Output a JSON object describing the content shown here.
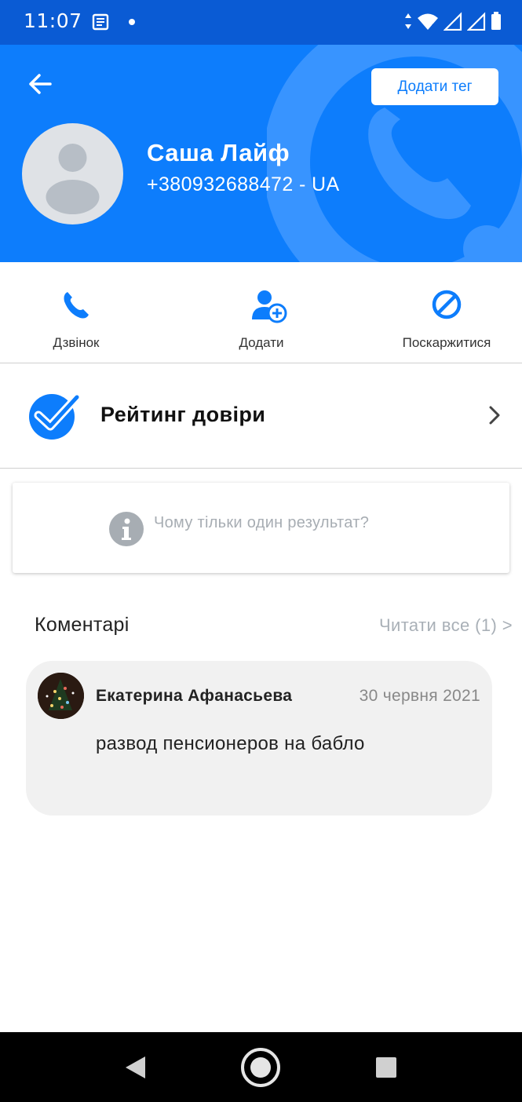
{
  "status_bar": {
    "time": "11:07",
    "icons": [
      "news-icon",
      "notification-dot",
      "data-arrows-icon",
      "wifi-icon",
      "signal-icon",
      "signal-icon-2",
      "battery-icon"
    ]
  },
  "header": {
    "add_tag_label": "Додати тег",
    "contact_name": "Саша Лайф",
    "contact_phone": "+380932688472 - UA",
    "background_color": "#0d7dfc"
  },
  "actions": [
    {
      "label": "Дзвінок",
      "icon": "phone-icon"
    },
    {
      "label": "Додати",
      "icon": "add-contact-icon"
    },
    {
      "label": "Поскаржитися",
      "icon": "block-icon"
    }
  ],
  "trust": {
    "label": "Рейтинг довіри",
    "icon": "checkmark-badge-icon"
  },
  "info": {
    "text": "Чому тільки один результат?",
    "icon": "info-icon"
  },
  "comments": {
    "title": "Коментарі",
    "read_all": "Читати все (1) >",
    "items": [
      {
        "author": "Екатерина Афанасьева",
        "date": "30 червня 2021",
        "text": "развод пенсионеров на бабло"
      }
    ]
  },
  "nav_bar": {
    "buttons": [
      "back-triangle-icon",
      "home-circle-icon",
      "recents-square-icon"
    ]
  },
  "colors": {
    "accent": "#0d7dfc",
    "status_bar": "#0a5bd4",
    "muted_text": "#a7adb3"
  }
}
